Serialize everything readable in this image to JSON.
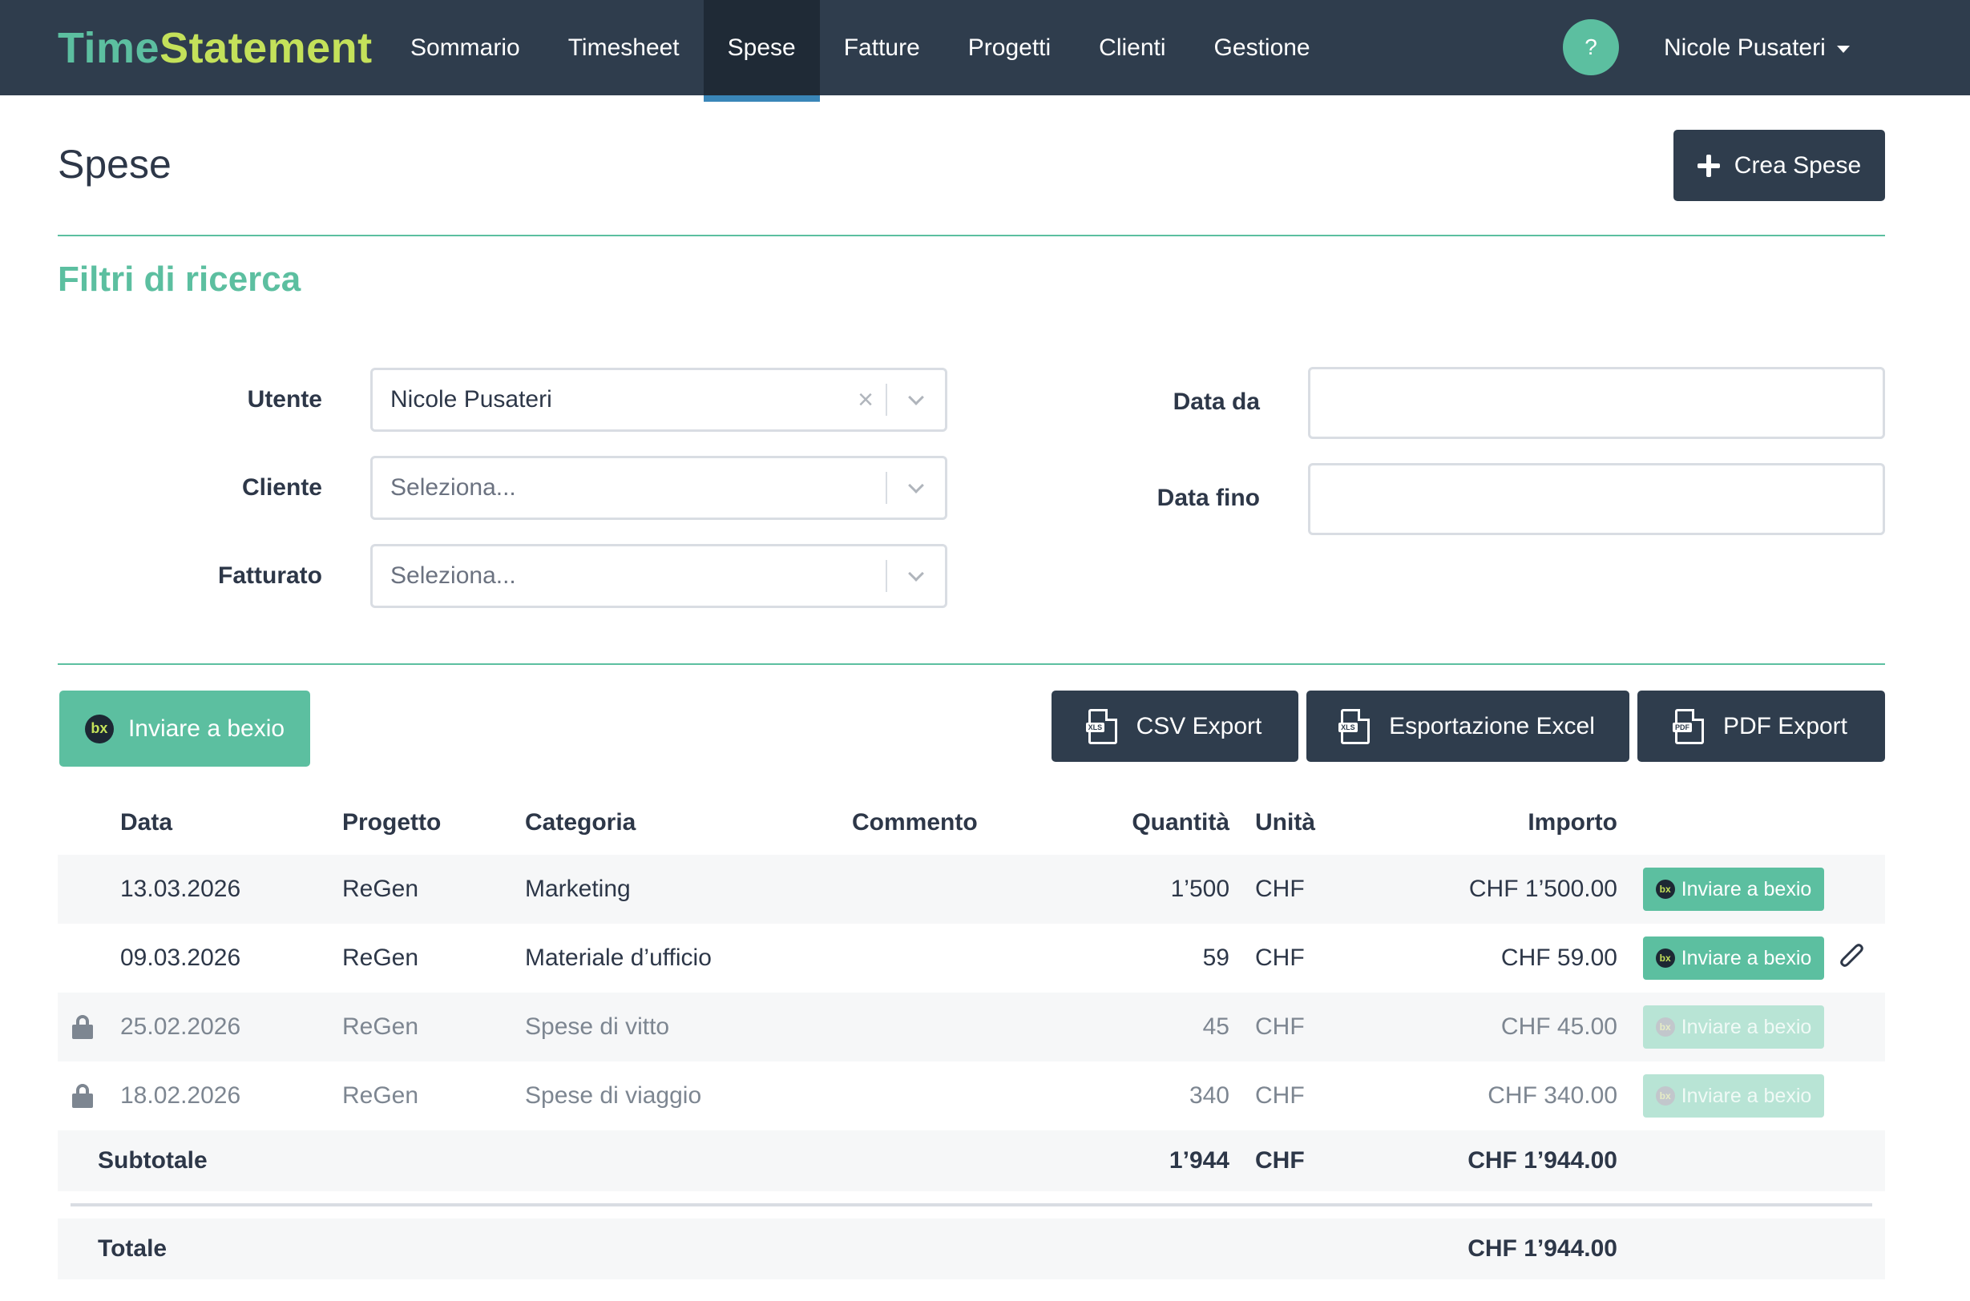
{
  "app": {
    "logo_part1": "Time",
    "logo_part2": "Statement",
    "nav": [
      "Sommario",
      "Timesheet",
      "Spese",
      "Fatture",
      "Progetti",
      "Clienti",
      "Gestione"
    ],
    "active_nav": "Spese",
    "help_label": "?",
    "user_name": "Nicole Pusateri"
  },
  "header": {
    "title": "Spese",
    "create_label": "Crea Spese"
  },
  "filters": {
    "title": "Filtri di ricerca",
    "utente_label": "Utente",
    "utente_value": "Nicole Pusateri",
    "cliente_label": "Cliente",
    "cliente_placeholder": "Seleziona...",
    "fatturato_label": "Fatturato",
    "fatturato_placeholder": "Seleziona...",
    "data_da_label": "Data da",
    "data_da_value": "",
    "data_fino_label": "Data fino",
    "data_fino_value": ""
  },
  "actions": {
    "bexio_label": "Inviare a bexio",
    "csv_label": "CSV Export",
    "excel_label": "Esportazione Excel",
    "pdf_label": "PDF Export",
    "csv_icon": "XLS",
    "excel_icon": "XLS",
    "pdf_icon": "PDF"
  },
  "table": {
    "headers": {
      "data": "Data",
      "progetto": "Progetto",
      "categoria": "Categoria",
      "commento": "Commento",
      "quantita": "Quantità",
      "unita": "Unità",
      "importo": "Importo"
    },
    "rows": [
      {
        "data": "13.03.2026",
        "progetto": "ReGen",
        "categoria": "Marketing",
        "commento": "",
        "quantita": "1’500",
        "unita": "CHF",
        "importo": "CHF 1’500.00",
        "bexio": "Inviare a bexio",
        "locked": false,
        "attachment": false
      },
      {
        "data": "09.03.2026",
        "progetto": "ReGen",
        "categoria": "Materiale d’ufficio",
        "commento": "",
        "quantita": "59",
        "unita": "CHF",
        "importo": "CHF 59.00",
        "bexio": "Inviare a bexio",
        "locked": false,
        "attachment": true
      },
      {
        "data": "25.02.2026",
        "progetto": "ReGen",
        "categoria": "Spese di vitto",
        "commento": "",
        "quantita": "45",
        "unita": "CHF",
        "importo": "CHF 45.00",
        "bexio": "Inviare a bexio",
        "locked": true,
        "attachment": false
      },
      {
        "data": "18.02.2026",
        "progetto": "ReGen",
        "categoria": "Spese di viaggio",
        "commento": "",
        "quantita": "340",
        "unita": "CHF",
        "importo": "CHF 340.00",
        "bexio": "Inviare a bexio",
        "locked": true,
        "attachment": false
      }
    ],
    "subtotal": {
      "label": "Subtotale",
      "quantita": "1’944",
      "unita": "CHF",
      "importo": "CHF 1’944.00"
    },
    "total": {
      "label": "Totale",
      "importo": "CHF 1’944.00"
    }
  },
  "icons": {
    "bexio": "bx",
    "lock": "lock-icon",
    "attachment": "paperclip-icon",
    "plus": "plus-icon",
    "clear": "×"
  },
  "colors": {
    "nav_bg": "#2f3d4d",
    "accent_green": "#5cbfa0",
    "logo_yellow": "#c4e15a",
    "active_underline": "#3a86b8"
  }
}
